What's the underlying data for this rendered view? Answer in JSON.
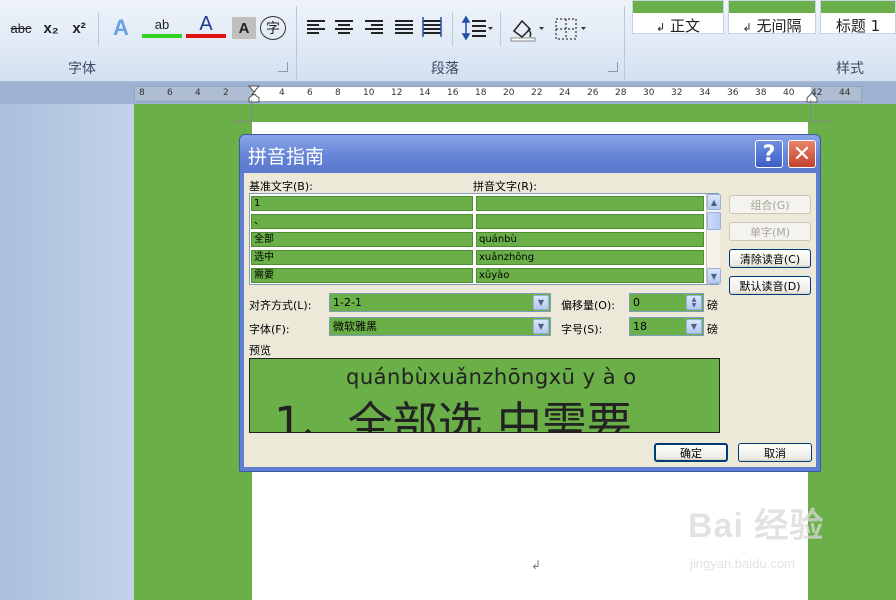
{
  "ribbon": {
    "font_tools": [
      "abc",
      "x₂",
      "x²",
      "A",
      "ab",
      "A",
      "A",
      "字"
    ],
    "groups": {
      "font": "字体",
      "paragraph": "段落",
      "styles": "样式"
    },
    "styles": [
      {
        "mark": "↲",
        "label": "正文"
      },
      {
        "mark": "↲",
        "label": "无间隔"
      },
      {
        "mark": "",
        "label": "标题 1"
      }
    ]
  },
  "ruler": {
    "numbers": [
      "8",
      "6",
      "4",
      "2",
      "2",
      "4",
      "6",
      "8",
      "10",
      "12",
      "14",
      "16",
      "18",
      "20",
      "22",
      "24",
      "26",
      "28",
      "30",
      "32",
      "34",
      "36",
      "38",
      "40",
      "42",
      "44"
    ]
  },
  "document": {
    "para_mark": "↲"
  },
  "watermark": {
    "logo": "Bai 经验",
    "url": "jingyan.baidu.com"
  },
  "dialog": {
    "title": "拼音指南",
    "help": "?",
    "close": "✕",
    "base_text_label": "基准文字(B):",
    "ruby_text_label": "拼音文字(R):",
    "rows": [
      {
        "base": "1",
        "ruby": ""
      },
      {
        "base": "、",
        "ruby": ""
      },
      {
        "base": "全部",
        "ruby": "quánbù"
      },
      {
        "base": "选中",
        "ruby": "xuǎnzhōng"
      },
      {
        "base": "需要",
        "ruby": "xūyào"
      }
    ],
    "buttons": {
      "group": "组合(G)",
      "single": "单字(M)",
      "clear": "清除读音(C)",
      "default": "默认读音(D)",
      "ok": "确定",
      "cancel": "取消"
    },
    "alignment_label": "对齐方式(L):",
    "alignment_value": "1-2-1",
    "offset_label": "偏移量(O):",
    "offset_value": "0",
    "offset_unit": "磅",
    "font_label": "字体(F):",
    "font_value": "微软雅黑",
    "size_label": "字号(S):",
    "size_value": "18",
    "size_unit": "磅",
    "preview_label": "预览",
    "preview_pinyin": "quánbùxuǎnzhōngxū y à o",
    "preview_text": "1、全部选 中需要"
  }
}
